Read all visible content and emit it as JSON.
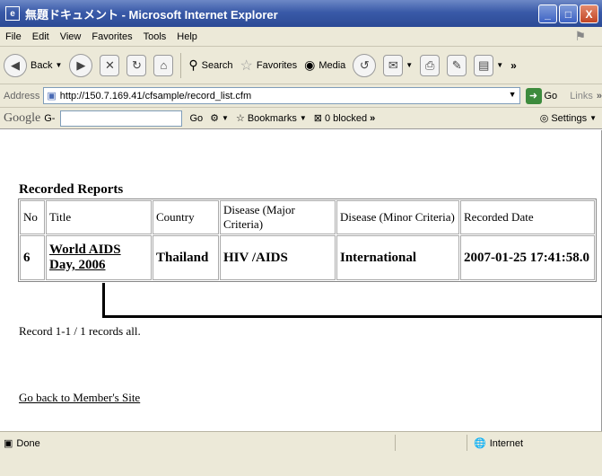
{
  "window": {
    "title": "無題ドキュメント - Microsoft Internet Explorer",
    "controls": [
      "_",
      "□",
      "X"
    ]
  },
  "menu": [
    "File",
    "Edit",
    "View",
    "Favorites",
    "Tools",
    "Help"
  ],
  "toolbar": {
    "back_label": "Back",
    "search_label": "Search",
    "favorites_label": "Favorites",
    "media_label": "Media"
  },
  "address": {
    "label": "Address",
    "url": "http://150.7.169.41/cfsample/record_list.cfm",
    "go_label": "Go",
    "links_label": "Links"
  },
  "google_toolbar": {
    "logo": "Google",
    "g_label": "G-",
    "go_label": "Go",
    "bookmarks_label": "Bookmarks",
    "blocked_label": "0 blocked",
    "settings_label": "Settings"
  },
  "page": {
    "heading": "Recorded Reports",
    "columns": [
      "No",
      "Title",
      "Country",
      "Disease (Major Criteria)",
      "Disease (Minor Criteria)",
      "Recorded Date"
    ],
    "rows": [
      {
        "no": "6",
        "title": "World AIDS Day, 2006",
        "country": "Thailand",
        "major": "HIV /AIDS",
        "minor": "International",
        "date": "2007-01-25 17:41:58.0"
      }
    ],
    "record_count": "Record 1-1 / 1 records all.",
    "back_link": "Go back to Member's Site"
  },
  "status": {
    "text": "Done",
    "zone": "Internet"
  }
}
